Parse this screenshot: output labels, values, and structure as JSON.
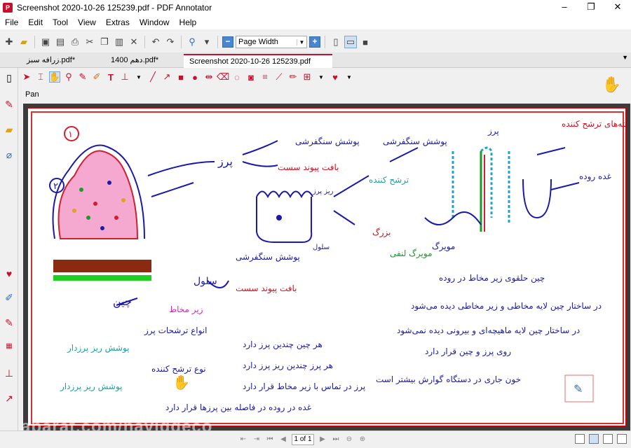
{
  "window": {
    "title": "Screenshot 2020-10-26 125239.pdf - PDF Annotator"
  },
  "menu": [
    "File",
    "Edit",
    "Tool",
    "View",
    "Extras",
    "Window",
    "Help"
  ],
  "toolbar": {
    "zoom_value": "Page Width"
  },
  "tabs": [
    {
      "label": "زرافه سبز.pdf*"
    },
    {
      "label": "1400 دهم.pdf*"
    },
    {
      "label": "Screenshot 2020-10-26 125239.pdf"
    }
  ],
  "mode_label": "Pan",
  "status": {
    "page_display": "1 of 1"
  },
  "watermark": "aparat.com/naviddeco",
  "notes": {
    "label_1": "۱",
    "label_2": "۲",
    "top_left_1": "پوشش سنگفرشی",
    "top_left_2": "پرز",
    "top_left_3": "بافت پیوند سست",
    "top_left_4": "ریز پرز",
    "left_side_1": "ریز پرز",
    "left_side_2": "سلول",
    "right_top_1": "پوشش سنگفرشی",
    "right_top_2": "پرز",
    "right_top_3": "یاخته‌های ترشح کننده",
    "right_top_4": "غده روده",
    "right_mid_1": "مویرگ",
    "right_mid_2": "مویرگ لنفی",
    "right_mid_3": "ترشح کننده",
    "right_mid_4": "بزرگ",
    "center_1": "پوشش سنگفرشی",
    "center_2": "سلول",
    "center_3": "بافت پیوند سست",
    "center_4": "زیر مخاط",
    "bottom_right_1": "چین حلقوی زیر مخاط در روده",
    "bottom_right_2": "در ساختار چین لایه مخاطی و زیر مخاطی دیده می‌شود",
    "bottom_right_3": "در ساختار چین لایه ماهیچه‌ای و بیرونی دیده نمی‌شود",
    "bottom_right_4": "روی پرز و چین قرار دارد",
    "bottom_right_5": "خون جاری در دستگاه گوارش بیشتر است",
    "bottom_left_1": "انواع ترشحات پرز",
    "bottom_left_2": "پوشش ریز پرزدار",
    "bottom_left_3": "نوع ترشح کننده",
    "bottom_left_4": "پوشش ریز پرزدار",
    "bottom_center_1": "هر چین چندین پرز دارد",
    "bottom_center_2": "هر پرز چندین ریز پرز دارد",
    "bottom_center_3": "پرز در تماس با زیر مخاط قرار دارد",
    "bottom_center_4": "غده در روده در فاصله بین پرزها قرار دارد",
    "chin": "چین"
  },
  "colors": {
    "accent_red": "#c8102e",
    "ink_blue": "#1a1aa8",
    "ink_red": "#d01020",
    "ink_green": "#1a9a2a",
    "ink_teal": "#20a0a0",
    "ink_magenta": "#e020c0"
  }
}
